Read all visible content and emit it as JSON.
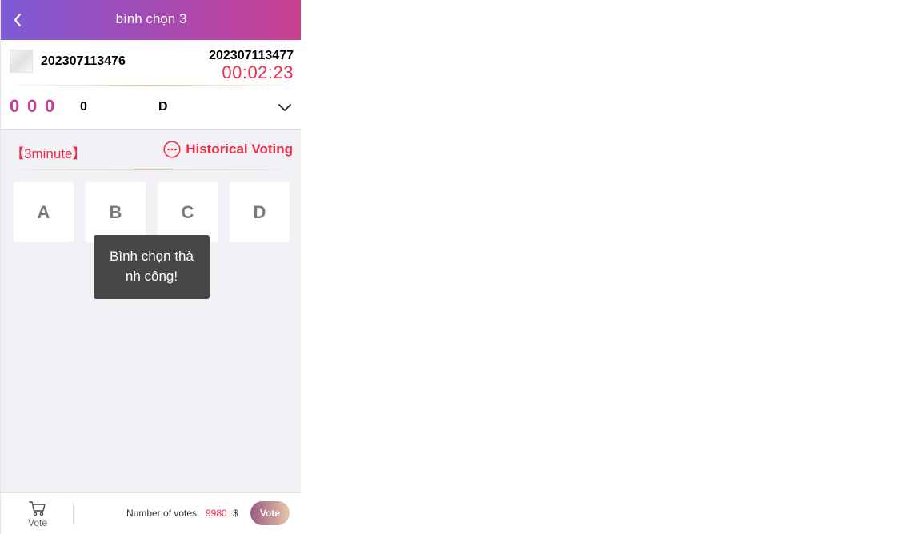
{
  "header": {
    "title": "bình chọn 3",
    "back_icon": "chevron-left-icon"
  },
  "period": {
    "previous": "202307113476",
    "current": "202307113477",
    "countdown": "00:02:23"
  },
  "result": {
    "balls": [
      "0",
      "0",
      "0"
    ],
    "sum": "0",
    "letter": "D",
    "expand_icon": "chevron-down-icon"
  },
  "game": {
    "mode_label": "【3minute】",
    "history_label": "Historical Voting",
    "history_icon": "more-circle-icon"
  },
  "options": [
    "A",
    "B",
    "C",
    "D"
  ],
  "toast": {
    "message": "Bình chọn thành công!"
  },
  "footer": {
    "cart_label": "Vote",
    "cart_icon": "cart-icon",
    "votes_label": "Number of votes:",
    "votes_value": "9980",
    "votes_unit": "$",
    "vote_button": "Vote"
  },
  "colors": {
    "accent": "#f02b47",
    "ball": "#c33f95",
    "header_gradient_start": "#7d5ad6",
    "header_gradient_end": "#c8408f"
  }
}
